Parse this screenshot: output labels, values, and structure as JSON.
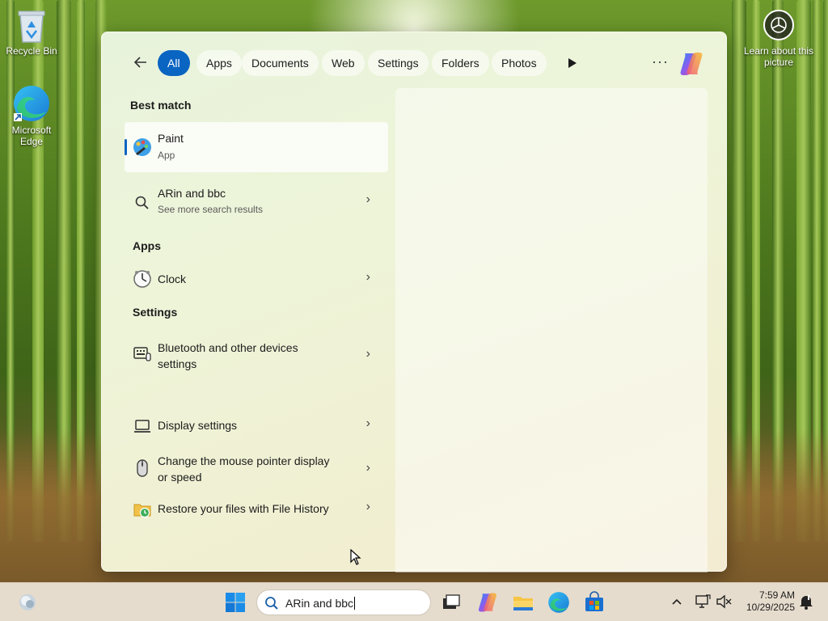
{
  "desktop": {
    "icons": [
      {
        "label": "Recycle Bin"
      },
      {
        "label": "Microsoft Edge"
      }
    ],
    "learn_label": "Learn about this picture"
  },
  "search_panel": {
    "filters": [
      "All",
      "Apps",
      "Documents",
      "Web",
      "Settings",
      "Folders",
      "Photos"
    ],
    "active_filter": "All",
    "more_label": "···",
    "best_match_heading": "Best match",
    "best_match": {
      "title": "Paint",
      "subtitle": "App"
    },
    "web_result": {
      "title": "ARin and bbc",
      "subtitle": "See more search results"
    },
    "apps_heading": "Apps",
    "apps": [
      {
        "title": "Clock"
      }
    ],
    "settings_heading": "Settings",
    "settings": [
      {
        "title": "Bluetooth and other devices settings",
        "line1": "Bluetooth and other devices",
        "line2": "settings"
      },
      {
        "title": "Display settings"
      },
      {
        "title": "Change the mouse pointer display or speed",
        "line1": "Change the mouse pointer display",
        "line2": "or speed"
      },
      {
        "title": "Restore your files with File History"
      }
    ]
  },
  "taskbar": {
    "search_value": "ARin and bbc",
    "time": "7:59 AM",
    "date": "10/29/2025"
  },
  "colors": {
    "accent": "#0a64c2",
    "taskbar": "#e6dccd"
  }
}
